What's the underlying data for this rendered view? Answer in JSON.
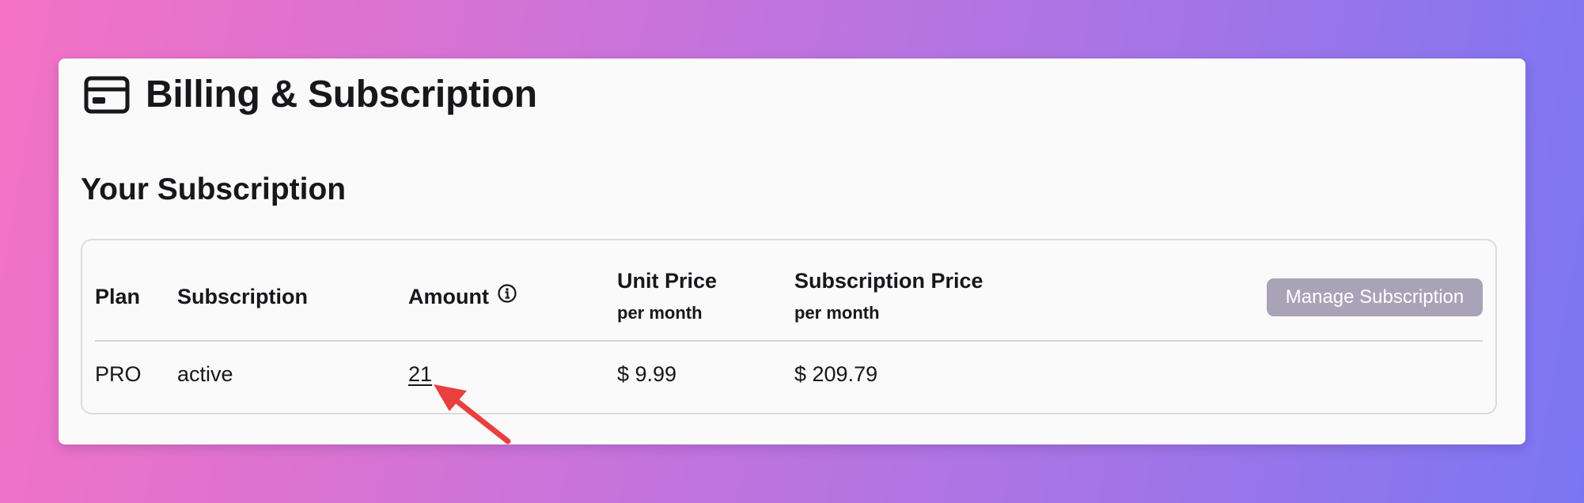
{
  "header": {
    "title": "Billing & Subscription",
    "icon": "credit-card-icon"
  },
  "section": {
    "title": "Your Subscription"
  },
  "table": {
    "columns": {
      "plan": "Plan",
      "subscription": "Subscription",
      "amount": "Amount",
      "unit_price": "Unit Price",
      "unit_price_sub": "per month",
      "subscription_price": "Subscription Price",
      "subscription_price_sub": "per month"
    },
    "row": {
      "plan": "PRO",
      "subscription": "active",
      "amount": "21",
      "unit_price": "$ 9.99",
      "subscription_price": "$ 209.79"
    },
    "manage_button": "Manage Subscription"
  },
  "colors": {
    "arrow": "#e8403f",
    "button_bg": "#a9a3b8",
    "card_bg": "#fafafa"
  }
}
